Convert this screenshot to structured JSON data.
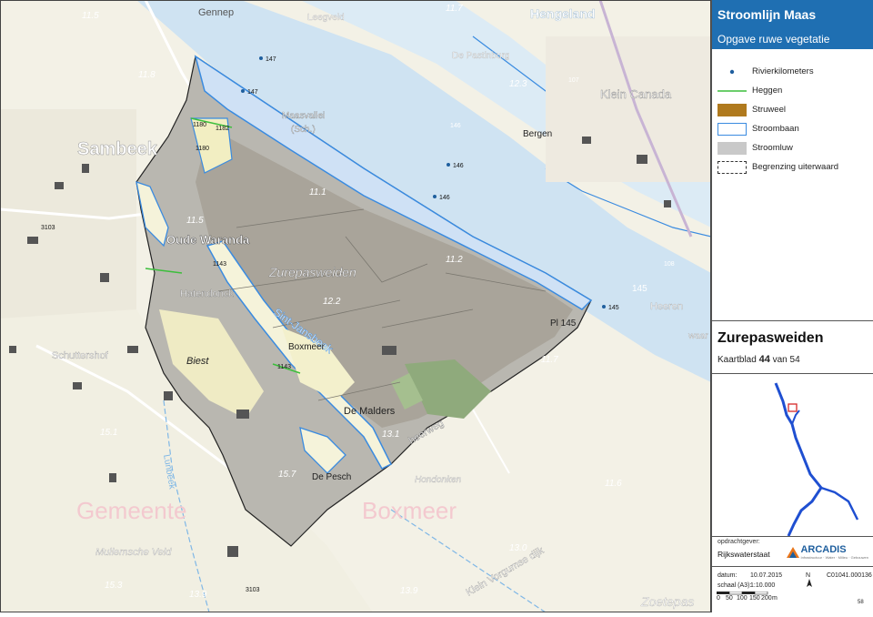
{
  "panel": {
    "title": "Stroomlijn Maas",
    "subtitle": "Opgave ruwe vegetatie",
    "legend": [
      {
        "label": "Rivierkilometers",
        "symbol": "dot-icon",
        "color": "#1f5f9e"
      },
      {
        "label": "Heggen",
        "symbol": "line-icon",
        "color": "#3cbe3c"
      },
      {
        "label": "Struweel",
        "symbol": "fill-icon",
        "color": "#b07a1e"
      },
      {
        "label": "Stroombaan",
        "symbol": "outline-fill-icon",
        "color": "#3a8be0"
      },
      {
        "label": "Stroomluw",
        "symbol": "fill-icon",
        "color": "#c9c9c9"
      },
      {
        "label": "Begrenzing uiterwaard",
        "symbol": "dashed-box-icon",
        "color": "#333333"
      }
    ],
    "area_name": "Zurepasweiden",
    "sheet_prefix": "Kaartblad",
    "sheet_number": "44",
    "sheet_suffix": "van 54",
    "client_label": "opdrachtgever:",
    "client_name": "Rijkswaterstaat",
    "logo_text": "ARCADIS",
    "logo_sub": "Infrastructuur · Water · Milieu · Gebouwen",
    "date_label": "datum:",
    "date_value": "10.07.2015",
    "scale_label": "schaal (A3):",
    "scale_value": "1:10.000",
    "north": "N",
    "doc_code": "C01041.000136",
    "scalebar_ticks": [
      "0",
      "50",
      "100",
      "150",
      "200",
      "m"
    ],
    "page_ref": "58"
  },
  "map": {
    "labels": {
      "gennep": "Gennep",
      "hengeland": "Hengeland",
      "sambeek": "Sambeek",
      "bergen": "Bergen",
      "klein_canada": "Klein Canada",
      "oude_waranda": "Oude Waranda",
      "zurepasweiden": "Zurepasweiden",
      "hatendonck": "Hatendonck",
      "sint_jansbeek": "Sint-Jansbeek",
      "boxmeer": "Boxmeer",
      "biest": "Biest",
      "schuttershof": "Schuttershof",
      "de_malders": "De Malders",
      "de_pesch": "De Pesch",
      "gemeente": "Gemeente",
      "boxmeer_big": "Boxmeer",
      "mullemsche_veld": "Mullemsche Veld",
      "heeren": "Heeren",
      "zoetepas": "Zoetepas",
      "de_pastinburg": "De Pastinburg",
      "hoogveld": "Leegveld",
      "maasvallei": "Maasvallei",
      "schans": "(Sch.)",
      "pi145": "Pl 145",
      "groenlanden": "Klein Vorgumse dijk",
      "hondonken": "Hondonken",
      "lunbeek": "Lunbeek",
      "heerweg": "heerweg",
      "waar": "waar"
    },
    "km_labels": [
      "147",
      "147",
      "146",
      "146",
      "146",
      "145",
      "145",
      "145"
    ],
    "heights": [
      "11.5",
      "11.8",
      "11.1",
      "11.5",
      "11.2",
      "12.2",
      "11.7",
      "13.1",
      "15.7",
      "15.1",
      "15.3",
      "13.9",
      "13.0",
      "11.6",
      "12.3",
      "11.7",
      "13.9"
    ],
    "codes": [
      "3103",
      "3103",
      "1180",
      "1182",
      "1180",
      "1143",
      "1143",
      "107",
      "108"
    ]
  }
}
